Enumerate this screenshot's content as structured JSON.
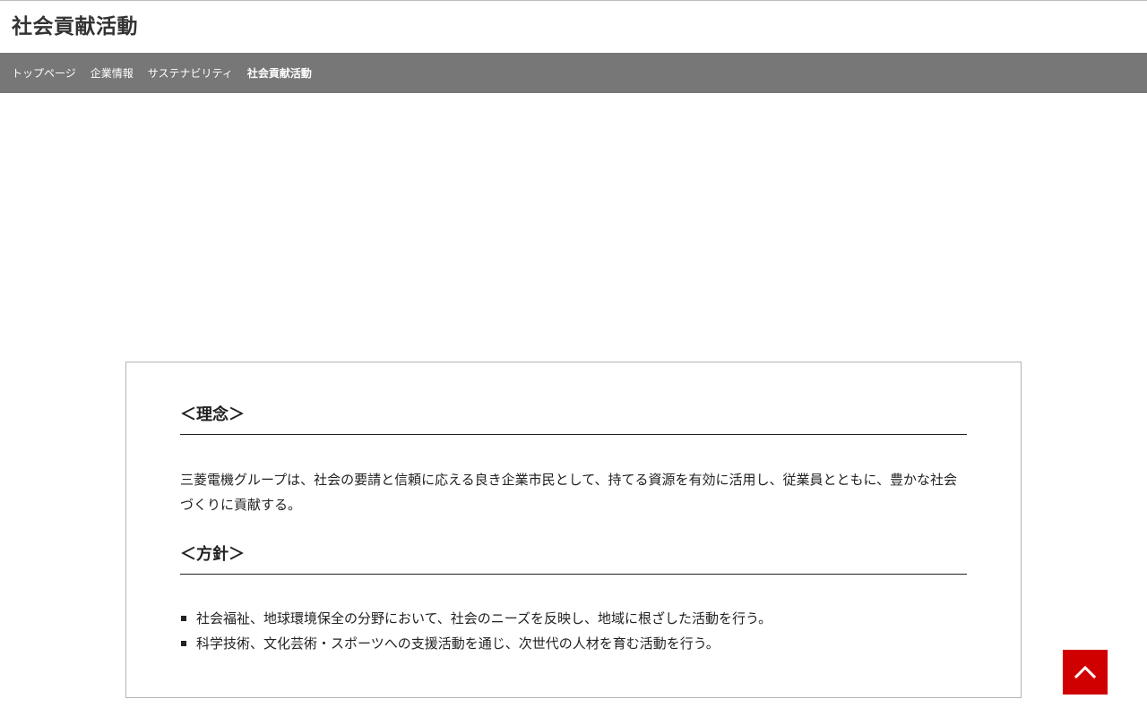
{
  "header": {
    "title": "社会貢献活動"
  },
  "breadcrumb": {
    "items": [
      {
        "label": "トップページ"
      },
      {
        "label": "企業情報"
      },
      {
        "label": "サステナビリティ"
      },
      {
        "label": "社会貢献活動"
      }
    ]
  },
  "content": {
    "philosophy": {
      "heading": "＜理念＞",
      "text": "三菱電機グループは、社会の要請と信頼に応える良き企業市民として、持てる資源を有効に活用し、従業員とともに、豊かな社会づくりに貢献する。"
    },
    "policy": {
      "heading": "＜方針＞",
      "items": [
        "社会福祉、地球環境保全の分野において、社会のニーズを反映し、地域に根ざした活動を行う。",
        "科学技術、文化芸術・スポーツへの支援活動を通じ、次世代の人材を育む活動を行う。"
      ]
    }
  },
  "colors": {
    "breadcrumb_bg": "#777777",
    "back_to_top_bg": "#d10000"
  },
  "icons": {
    "back_to_top": "chevron-up-icon"
  }
}
